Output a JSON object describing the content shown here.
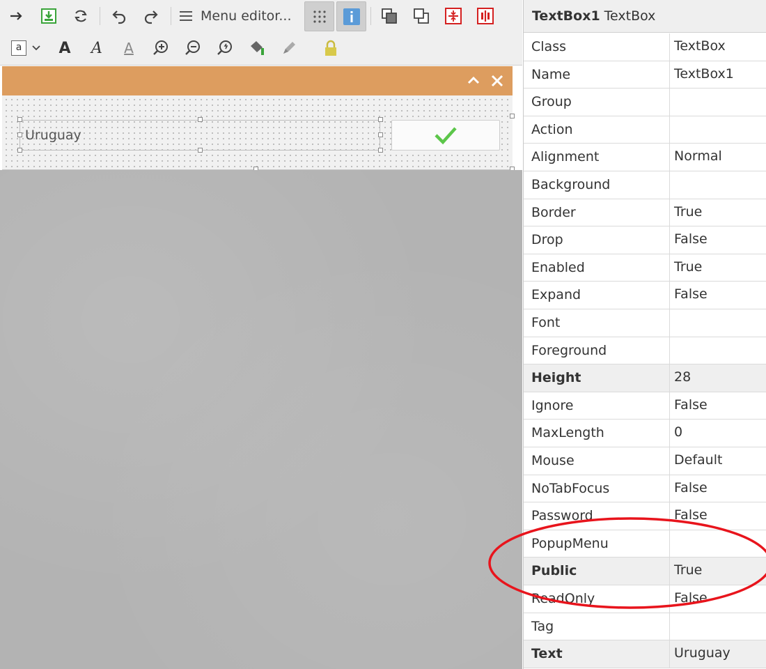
{
  "toolbar": {
    "menu_editor_label": "Menu editor...",
    "buttons": [
      "arrow-right-icon",
      "save-form-icon",
      "refresh-icon",
      "undo-icon",
      "redo-icon",
      "menu-icon",
      "grid-icon",
      "info-icon",
      "bring-to-front-icon",
      "send-to-back-icon",
      "same-height-icon",
      "same-width-icon",
      "text-icon",
      "font-bold-icon",
      "font-italic-icon",
      "font-underline-icon",
      "zoom-in-icon",
      "zoom-out-icon",
      "zoom-reset-icon",
      "fill-color-icon",
      "pencil-icon",
      "lock-icon"
    ],
    "text_button_label": "a"
  },
  "form": {
    "textbox_text": "Uruguay",
    "colors": {
      "titlebar": "#dd9d5f",
      "ok_check": "#5cc64a"
    }
  },
  "properties": {
    "object_name": "TextBox1",
    "object_class": "TextBox",
    "rows": [
      {
        "name": "Class",
        "value": "TextBox",
        "bold": false
      },
      {
        "name": "Name",
        "value": "TextBox1",
        "bold": false
      },
      {
        "name": "Group",
        "value": "",
        "bold": false
      },
      {
        "name": "Action",
        "value": "",
        "bold": false
      },
      {
        "name": "Alignment",
        "value": "Normal",
        "bold": false
      },
      {
        "name": "Background",
        "value": "",
        "bold": false
      },
      {
        "name": "Border",
        "value": "True",
        "bold": false
      },
      {
        "name": "Drop",
        "value": "False",
        "bold": false
      },
      {
        "name": "Enabled",
        "value": "True",
        "bold": false
      },
      {
        "name": "Expand",
        "value": "False",
        "bold": false
      },
      {
        "name": "Font",
        "value": "",
        "bold": false
      },
      {
        "name": "Foreground",
        "value": "",
        "bold": false
      },
      {
        "name": "Height",
        "value": "28",
        "bold": true
      },
      {
        "name": "Ignore",
        "value": "False",
        "bold": false
      },
      {
        "name": "MaxLength",
        "value": "0",
        "bold": false
      },
      {
        "name": "Mouse",
        "value": "Default",
        "bold": false
      },
      {
        "name": "NoTabFocus",
        "value": "False",
        "bold": false
      },
      {
        "name": "Password",
        "value": "False",
        "bold": false
      },
      {
        "name": "PopupMenu",
        "value": "",
        "bold": false
      },
      {
        "name": "Public",
        "value": "True",
        "bold": true
      },
      {
        "name": "ReadOnly",
        "value": "False",
        "bold": false
      },
      {
        "name": "Tag",
        "value": "",
        "bold": false
      },
      {
        "name": "Text",
        "value": "Uruguay",
        "bold": true
      }
    ]
  },
  "annotation": {
    "shape": "ellipse",
    "color": "#e8141c",
    "highlights": "Public"
  }
}
